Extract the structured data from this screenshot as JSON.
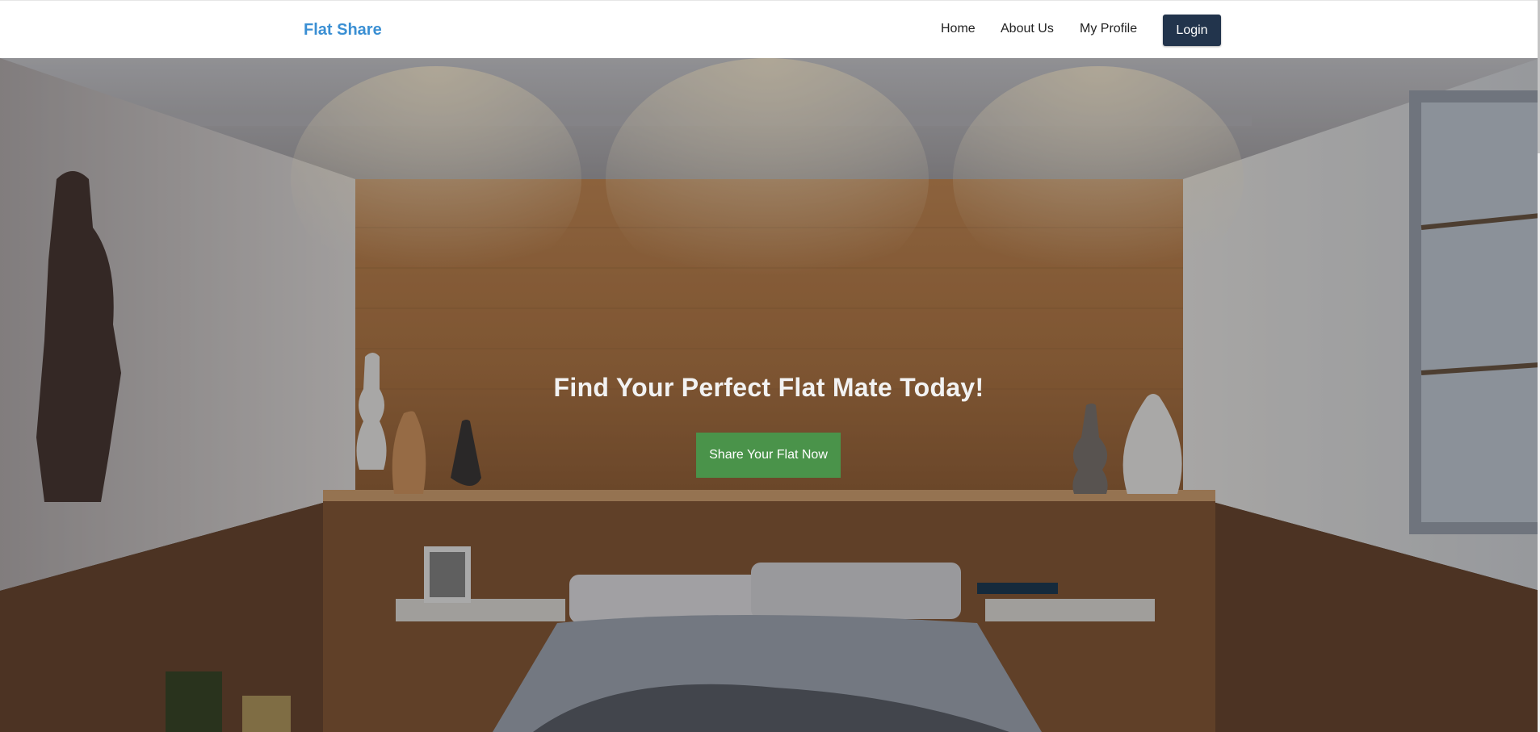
{
  "brand": "Flat Share",
  "nav": {
    "links": [
      "Home",
      "About Us",
      "My Profile"
    ],
    "login_label": "Login"
  },
  "hero": {
    "title": "Find Your Perfect Flat Mate Today!",
    "cta_label": "Share Your Flat Now"
  },
  "colors": {
    "brand": "#3a8fd3",
    "login_bg": "#22344c",
    "cta_bg": "#4a934a"
  }
}
